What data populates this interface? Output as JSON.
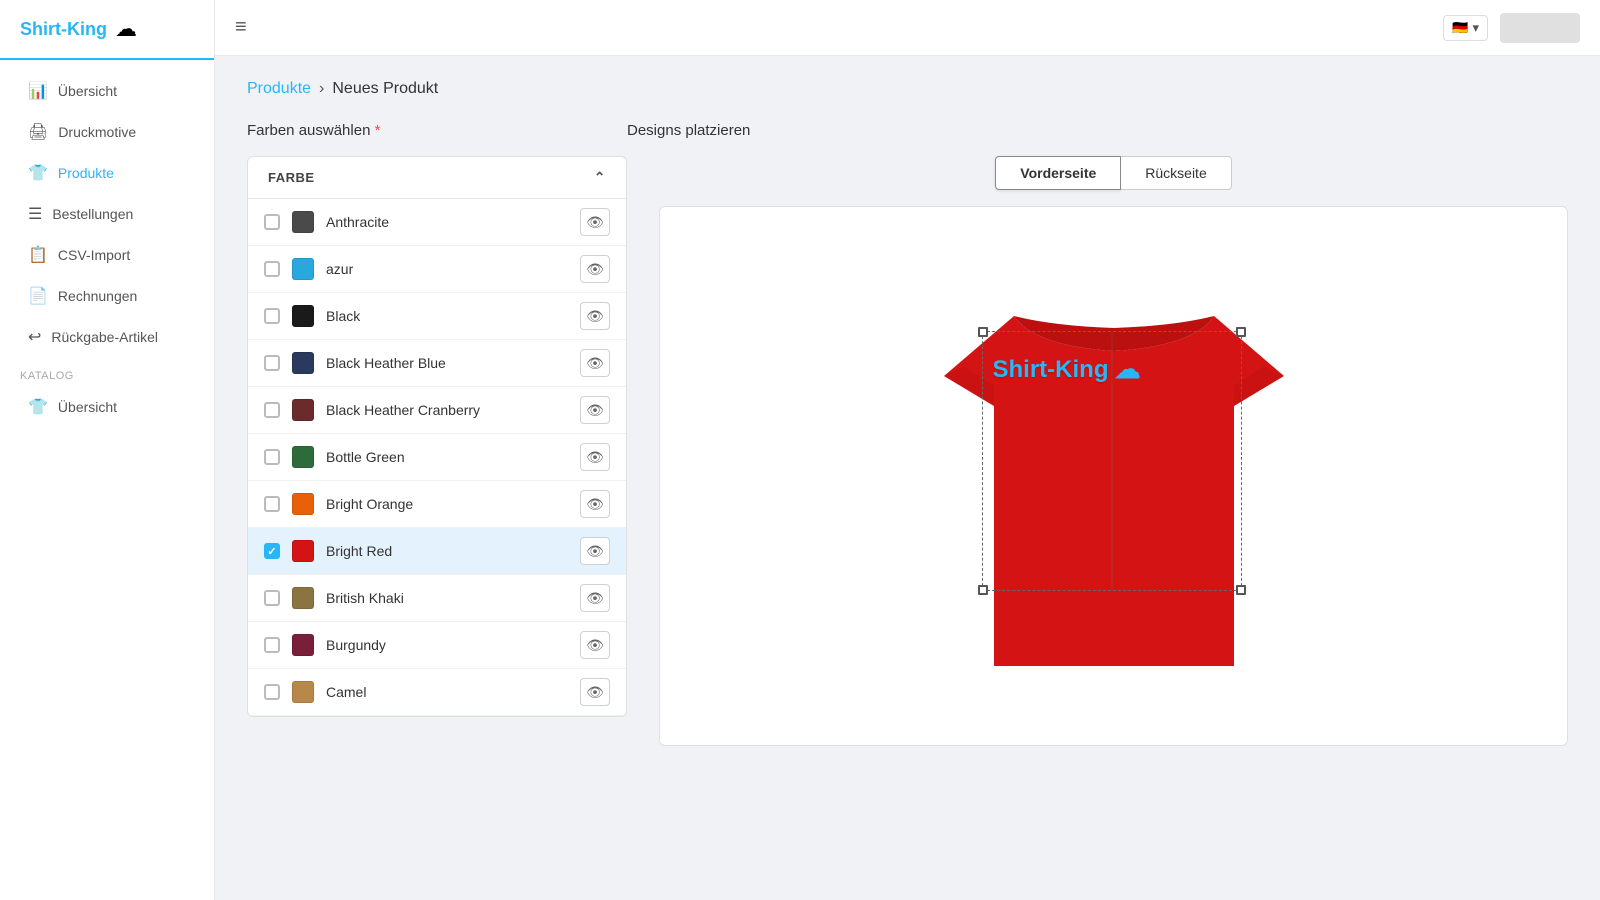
{
  "sidebar": {
    "logo": {
      "text": "Shirt-King",
      "icon": "☁"
    },
    "nav_items": [
      {
        "id": "uebersicht",
        "label": "Übersicht",
        "icon": "📊",
        "active": false
      },
      {
        "id": "druckmotive",
        "label": "Druckmotive",
        "icon": "🖨",
        "active": false
      },
      {
        "id": "produkte",
        "label": "Produkte",
        "icon": "👕",
        "active": true
      },
      {
        "id": "bestellungen",
        "label": "Bestellungen",
        "icon": "☰",
        "active": false
      },
      {
        "id": "csv-import",
        "label": "CSV-Import",
        "icon": "📋",
        "active": false
      },
      {
        "id": "rechnungen",
        "label": "Rechnungen",
        "icon": "📄",
        "active": false
      },
      {
        "id": "rueckgabe",
        "label": "Rückgabe-Artikel",
        "icon": "↩",
        "active": false
      }
    ],
    "katalog_label": "KATALOG",
    "katalog_items": [
      {
        "id": "katalog-uebersicht",
        "label": "Übersicht",
        "icon": "👕"
      }
    ]
  },
  "topbar": {
    "hamburger_label": "≡",
    "flag": "🇩🇪",
    "flag_arrow": "▾"
  },
  "breadcrumb": {
    "link": "Produkte",
    "separator": "›",
    "current": "Neues Produkt"
  },
  "farben_section": {
    "title": "Farben auswählen",
    "required_marker": " *",
    "column_header": "FARBE",
    "collapse_icon": "⌃",
    "colors": [
      {
        "id": "anthracite",
        "name": "Anthracite",
        "swatch": "#4a4a4a",
        "checked": false,
        "selected": false
      },
      {
        "id": "azur",
        "name": "azur",
        "swatch": "#29a8e0",
        "checked": false,
        "selected": false
      },
      {
        "id": "black",
        "name": "Black",
        "swatch": "#1a1a1a",
        "checked": false,
        "selected": false
      },
      {
        "id": "black-heather-blue",
        "name": "Black Heather Blue",
        "swatch": "#2a3a5c",
        "checked": false,
        "selected": false
      },
      {
        "id": "black-heather-cranberry",
        "name": "Black Heather Cranberry",
        "swatch": "#6b2b2b",
        "checked": false,
        "selected": false
      },
      {
        "id": "bottle-green",
        "name": "Bottle Green",
        "swatch": "#2d6b3a",
        "checked": false,
        "selected": false
      },
      {
        "id": "bright-orange",
        "name": "Bright Orange",
        "swatch": "#e8610a",
        "checked": false,
        "selected": false
      },
      {
        "id": "bright-red",
        "name": "Bright Red",
        "swatch": "#d41414",
        "checked": true,
        "selected": true
      },
      {
        "id": "british-khaki",
        "name": "British Khaki",
        "swatch": "#8a7442",
        "checked": false,
        "selected": false
      },
      {
        "id": "burgundy",
        "name": "Burgundy",
        "swatch": "#7a1f3a",
        "checked": false,
        "selected": false
      },
      {
        "id": "camel",
        "name": "Camel",
        "swatch": "#b8884a",
        "checked": false,
        "selected": false
      }
    ]
  },
  "designs_section": {
    "title": "Designs platzieren",
    "tabs": [
      {
        "id": "vorderseite",
        "label": "Vorderseite",
        "active": true
      },
      {
        "id": "rueckseite",
        "label": "Rückseite",
        "active": false
      }
    ],
    "shirt_color": "#d41414",
    "design_text": "Shirt-King ☁",
    "design_text_color": "#29b6f6"
  }
}
